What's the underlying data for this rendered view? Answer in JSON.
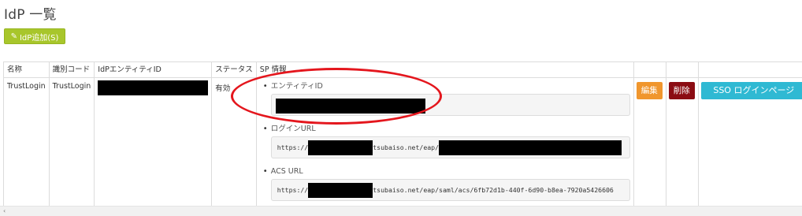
{
  "page": {
    "title": "IdP 一覧"
  },
  "toolbar": {
    "add_label": "IdP追加(S)",
    "add_icon": "edit-icon"
  },
  "table": {
    "headers": [
      "名称",
      "識別コード",
      "IdPエンティティID",
      "ステータス",
      "SP 情報",
      "",
      "",
      ""
    ],
    "row": {
      "name": "TrustLogin",
      "code": "TrustLogin",
      "status": "有効",
      "sp": {
        "entity_label": "エンティティID",
        "login_url_label": "ログインURL",
        "login_url_prefix": "https://",
        "login_url_middle": "tsubaiso.net/eap/",
        "acs_url_label": "ACS URL",
        "acs_url_prefix": "https://",
        "acs_url_middle": "tsubaiso.net/eap/saml/acs/6fb72d1b-440f-6d90-b8ea-7920a5426606"
      },
      "edit_label": "編集",
      "delete_label": "削除",
      "sso_label": "SSO ログインページ"
    }
  },
  "colors": {
    "add_button": "#a8c62b",
    "edit_button": "#f0962d",
    "delete_button": "#8b0c13",
    "sso_button": "#2fb9d3",
    "annotation": "#e4161d"
  },
  "scrollbar": {
    "left_arrow": "‹"
  }
}
